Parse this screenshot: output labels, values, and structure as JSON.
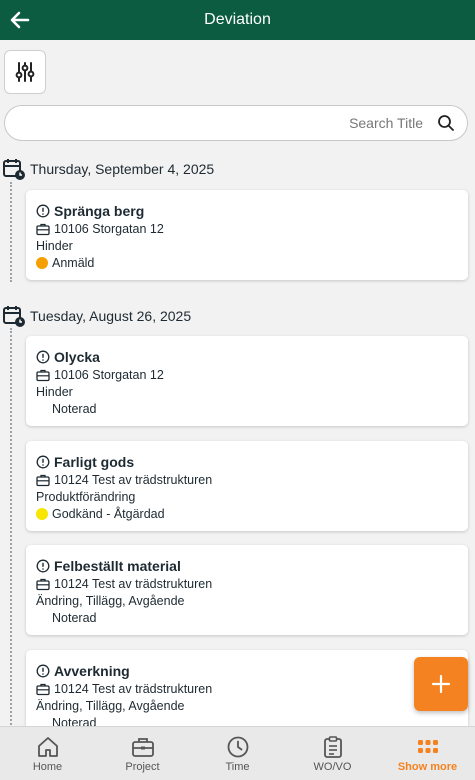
{
  "header": {
    "title": "Deviation"
  },
  "search": {
    "placeholder": "Search Title",
    "value": ""
  },
  "groups": [
    {
      "date": "Thursday, September 4, 2025",
      "items": [
        {
          "title": "Spränga berg",
          "project": "10106 Storgatan 12",
          "category": "Hinder",
          "status": "Anmäld",
          "status_color": "#f5a000"
        }
      ]
    },
    {
      "date": "Tuesday, August 26, 2025",
      "items": [
        {
          "title": "Olycka",
          "project": "10106 Storgatan 12",
          "category": "Hinder",
          "status": "Noterad",
          "status_color": ""
        },
        {
          "title": "Farligt gods",
          "project": "10124 Test av trädstrukturen",
          "category": "Produktförändring",
          "status": "Godkänd - Åtgärdad",
          "status_color": "#f6e600"
        },
        {
          "title": "Felbeställt material",
          "project": "10124 Test av trädstrukturen",
          "category": "Ändring, Tillägg, Avgående",
          "status": "Noterad",
          "status_color": ""
        },
        {
          "title": "Avverkning",
          "project": "10124 Test av trädstrukturen",
          "category": "Ändring, Tillägg, Avgående",
          "status": "Noterad",
          "status_color": ""
        }
      ]
    }
  ],
  "nav": [
    {
      "label": "Home",
      "icon": "home-icon"
    },
    {
      "label": "Project",
      "icon": "briefcase-icon"
    },
    {
      "label": "Time",
      "icon": "clock-icon"
    },
    {
      "label": "WO/VO",
      "icon": "clipboard-icon"
    },
    {
      "label": "Show more",
      "icon": "grid-dots-icon",
      "active": true
    }
  ],
  "colors": {
    "header": "#0c5c41",
    "accent": "#f58220"
  }
}
